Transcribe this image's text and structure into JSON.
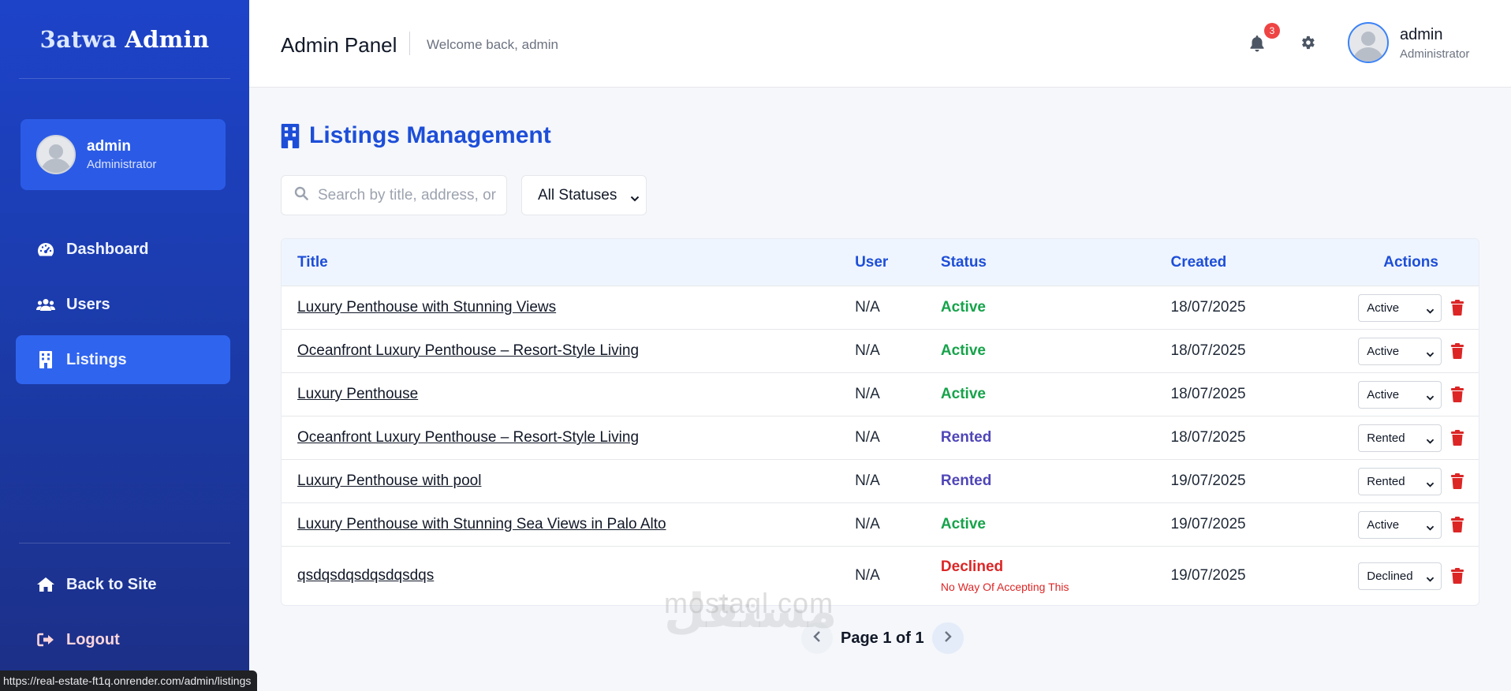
{
  "brand": {
    "part1": "3atwa",
    "part2": "Admin"
  },
  "sidebar": {
    "user": {
      "name": "admin",
      "role": "Administrator"
    },
    "items": [
      {
        "label": "Dashboard",
        "icon": "dashboard-icon"
      },
      {
        "label": "Users",
        "icon": "users-icon"
      },
      {
        "label": "Listings",
        "icon": "building-icon",
        "active": true
      }
    ],
    "bottom": [
      {
        "label": "Back to Site",
        "icon": "home-icon"
      },
      {
        "label": "Logout",
        "icon": "logout-icon"
      }
    ]
  },
  "header": {
    "title": "Admin Panel",
    "welcome": "Welcome back, admin",
    "notifications": "3",
    "user": {
      "name": "admin",
      "role": "Administrator"
    }
  },
  "main": {
    "title": "Listings Management",
    "search_placeholder": "Search by title, address, or",
    "status_filter": "All Statuses",
    "table": {
      "headers": [
        "Title",
        "User",
        "Status",
        "Created",
        "Actions"
      ],
      "rows": [
        {
          "title": "Luxury Penthouse with Stunning Views",
          "user": "N/A",
          "status": "Active",
          "created": "18/07/2025",
          "action": "Active"
        },
        {
          "title": "Oceanfront Luxury Penthouse – Resort-Style Living",
          "user": "N/A",
          "status": "Active",
          "created": "18/07/2025",
          "action": "Active"
        },
        {
          "title": "Luxury Penthouse",
          "user": "N/A",
          "status": "Active",
          "created": "18/07/2025",
          "action": "Active"
        },
        {
          "title": "Oceanfront Luxury Penthouse – Resort-Style Living",
          "user": "N/A",
          "status": "Rented",
          "created": "18/07/2025",
          "action": "Rented"
        },
        {
          "title": "Luxury Penthouse with pool",
          "user": "N/A",
          "status": "Rented",
          "created": "19/07/2025",
          "action": "Rented"
        },
        {
          "title": "Luxury Penthouse with Stunning Sea Views in Palo Alto",
          "user": "N/A",
          "status": "Active",
          "created": "19/07/2025",
          "action": "Active"
        },
        {
          "title": "qsdqsdqsdqsdqsdqs",
          "user": "N/A",
          "status": "Declined",
          "reason": "No Way Of Accepting This",
          "created": "19/07/2025",
          "action": "Declined"
        }
      ]
    },
    "pagination": "Page 1 of 1"
  },
  "watermark": {
    "ar": "مستقل",
    "en": "mostaql.com"
  },
  "statusbar": "https://real-estate-ft1q.onrender.com/admin/listings",
  "colors": {
    "primary": "#1d4ed8",
    "active": "#16a34a",
    "rented": "#4f46b8",
    "declined": "#dc2626",
    "sidebar": "#1d43c9"
  }
}
